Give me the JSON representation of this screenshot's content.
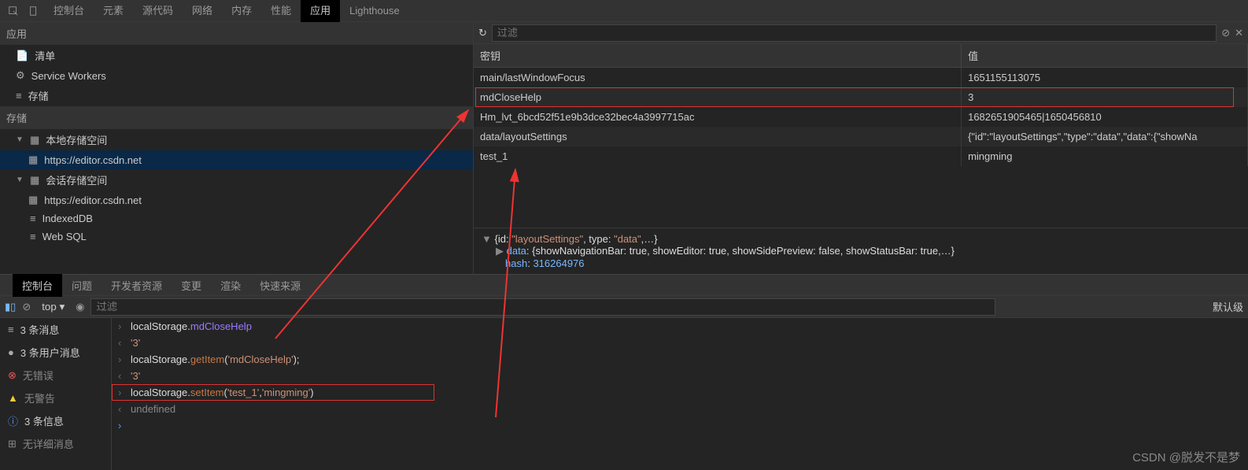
{
  "topTabs": [
    "控制台",
    "元素",
    "源代码",
    "网络",
    "内存",
    "性能",
    "应用",
    "Lighthouse"
  ],
  "topActiveIndex": 6,
  "appSection": {
    "title": "应用",
    "items": [
      {
        "icon": "file",
        "label": "清单"
      },
      {
        "icon": "gear",
        "label": "Service Workers"
      },
      {
        "icon": "db",
        "label": "存储"
      }
    ]
  },
  "storageSection": {
    "title": "存储",
    "groups": [
      {
        "toggle": "▼",
        "icon": "grid",
        "label": "本地存储空间",
        "children": [
          {
            "icon": "grid",
            "label": "https://editor.csdn.net",
            "selected": true
          }
        ]
      },
      {
        "toggle": "▼",
        "icon": "grid",
        "label": "会话存储空间",
        "children": [
          {
            "icon": "grid",
            "label": "https://editor.csdn.net"
          }
        ]
      },
      {
        "toggle": "",
        "icon": "db",
        "label": "IndexedDB"
      },
      {
        "toggle": "",
        "icon": "db",
        "label": "Web SQL"
      }
    ]
  },
  "storageToolbar": {
    "filterPlaceholder": "过滤"
  },
  "storageTable": {
    "headers": {
      "key": "密钥",
      "value": "值"
    },
    "rows": [
      {
        "key": "main/lastWindowFocus",
        "value": "1651155113075"
      },
      {
        "key": "mdCloseHelp",
        "value": "3",
        "highlight": true
      },
      {
        "key": "Hm_lvt_6bcd52f51e9b3dce32bec4a3997715ac",
        "value": "1682651905465|1650456810"
      },
      {
        "key": "data/layoutSettings",
        "value": "{\"id\":\"layoutSettings\",\"type\":\"data\",\"data\":{\"showNa"
      },
      {
        "key": "test_1",
        "value": "mingming"
      }
    ]
  },
  "detail": {
    "line1_pre": "{id: ",
    "line1_id": "\"layoutSettings\"",
    "line1_mid": ", type: ",
    "line1_type": "\"data\"",
    "line1_post": ",…}",
    "line2_key": "data",
    "line2_val": ": {showNavigationBar: true, showEditor: true, showSidePreview: false, showStatusBar: true,…}",
    "line3_key": "hash",
    "line3_val": "316264976"
  },
  "drawerTabs": [
    "控制台",
    "问题",
    "开发者资源",
    "变更",
    "渲染",
    "快速来源"
  ],
  "drawerActiveIndex": 0,
  "consoleToolbar": {
    "context": "top ▾",
    "filterPlaceholder": "过滤",
    "levels": "默认级"
  },
  "consoleSidebar": [
    {
      "icon": "list",
      "label": "3 条消息"
    },
    {
      "icon": "user",
      "label": "3 条用户消息"
    },
    {
      "icon": "error",
      "label": "无错误",
      "muted": true
    },
    {
      "icon": "warn",
      "label": "无警告",
      "muted": true
    },
    {
      "icon": "info",
      "label": "3 条信息"
    },
    {
      "icon": "debug",
      "label": "无详细消息",
      "muted": true
    }
  ],
  "consoleLines": [
    {
      "t": "in",
      "parts": [
        {
          "c": "code-obj",
          "v": "localStorage."
        },
        {
          "c": "prop",
          "v": "mdCloseHelp"
        }
      ]
    },
    {
      "t": "out",
      "parts": [
        {
          "c": "str",
          "v": "'3'"
        }
      ]
    },
    {
      "t": "in",
      "parts": [
        {
          "c": "code-obj",
          "v": "localStorage."
        },
        {
          "c": "method",
          "v": "getItem"
        },
        {
          "c": "code-obj",
          "v": "("
        },
        {
          "c": "str",
          "v": "'mdCloseHelp'"
        },
        {
          "c": "code-obj",
          "v": ");"
        }
      ]
    },
    {
      "t": "out",
      "parts": [
        {
          "c": "str",
          "v": "'3'"
        }
      ]
    },
    {
      "t": "in",
      "box": true,
      "parts": [
        {
          "c": "code-obj",
          "v": "localStorage."
        },
        {
          "c": "method",
          "v": "setItem"
        },
        {
          "c": "code-obj",
          "v": "("
        },
        {
          "c": "str",
          "v": "'test_1'"
        },
        {
          "c": "code-obj",
          "v": ","
        },
        {
          "c": "str",
          "v": "'mingming'"
        },
        {
          "c": "code-obj",
          "v": ")"
        }
      ]
    },
    {
      "t": "out",
      "parts": [
        {
          "c": "undef",
          "v": "undefined"
        }
      ]
    },
    {
      "t": "prompt",
      "parts": []
    }
  ],
  "watermark": "CSDN @脱发不是梦"
}
